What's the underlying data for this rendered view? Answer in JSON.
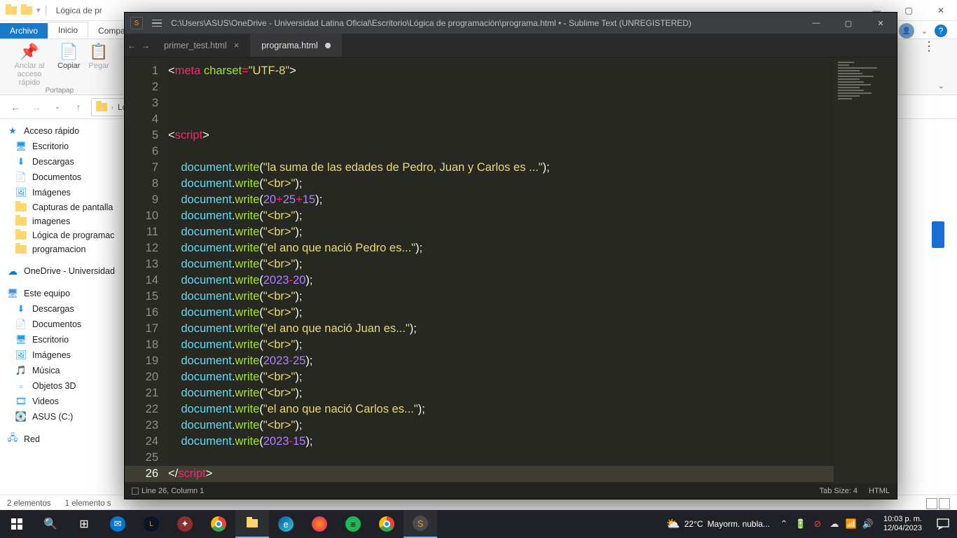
{
  "explorer": {
    "title": "Lógica de pr",
    "ribbon": {
      "tabs": {
        "file": "Archivo",
        "home": "Inicio",
        "share": "Compa"
      },
      "items": {
        "pin": "Anclar al acceso rápido",
        "copy": "Copiar",
        "paste": "Pegar",
        "group_clipboard": "Portapap"
      }
    },
    "address": {
      "folder": "Lóg"
    },
    "sidebar": {
      "quick": "Acceso rápido",
      "desktop": "Escritorio",
      "downloads": "Descargas",
      "documents": "Documentos",
      "pictures": "Imágenes",
      "captures": "Capturas de pantalla",
      "imagenes2": "imagenes",
      "logica": "Lógica de programac",
      "programacion": "programacion",
      "onedrive": "OneDrive - Universidad",
      "thispc": "Este equipo",
      "downloads2": "Descargas",
      "documents2": "Documentos",
      "desktop2": "Escritorio",
      "pictures2": "Imágenes",
      "music": "Música",
      "objects3d": "Objetos 3D",
      "videos": "Videos",
      "diskc": "ASUS (C:)",
      "network": "Red"
    },
    "status": {
      "count": "2 elementos",
      "selected": "1 elemento s"
    }
  },
  "sublime": {
    "title": "C:\\Users\\ASUS\\OneDrive - Universidad Latina Oficial\\Escritorio\\Lógica de programación\\programa.html • - Sublime Text (UNREGISTERED)",
    "tabs": {
      "t1": "primer_test.html",
      "t2": "programa.html"
    },
    "status": {
      "pos": "Line 26, Column 1",
      "tabsize": "Tab Size: 4",
      "syntax": "HTML"
    },
    "code": {
      "lines": [
        "1",
        "2",
        "3",
        "4",
        "5",
        "6",
        "7",
        "8",
        "9",
        "10",
        "11",
        "12",
        "13",
        "14",
        "15",
        "16",
        "17",
        "18",
        "19",
        "20",
        "21",
        "22",
        "23",
        "24",
        "25",
        "26"
      ]
    }
  },
  "taskbar": {
    "weather_temp": "22°C",
    "weather_text": "Mayorm. nubla...",
    "time": "10:03 p. m.",
    "date": "12/04/2023"
  }
}
